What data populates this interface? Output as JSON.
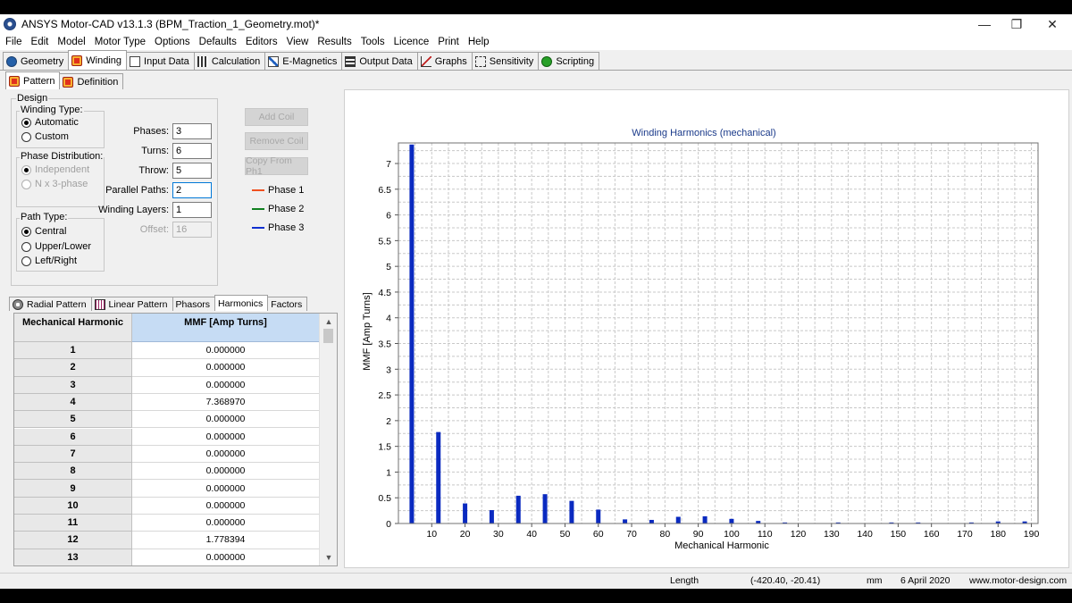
{
  "window": {
    "title": "ANSYS Motor-CAD v13.1.3 (BPM_Traction_1_Geometry.mot)*",
    "minimize": "—",
    "restore": "❐",
    "close": "✕"
  },
  "menu": [
    "File",
    "Edit",
    "Model",
    "Motor Type",
    "Options",
    "Defaults",
    "Editors",
    "View",
    "Results",
    "Tools",
    "Licence",
    "Print",
    "Help"
  ],
  "main_tabs": [
    "Geometry",
    "Winding",
    "Input Data",
    "Calculation",
    "E-Magnetics",
    "Output Data",
    "Graphs",
    "Sensitivity",
    "Scripting"
  ],
  "sub_tabs": [
    "Pattern",
    "Definition"
  ],
  "design": {
    "group_label": "Design",
    "winding_type": {
      "label": "Winding Type:",
      "options": [
        "Automatic",
        "Custom"
      ],
      "selected": "Automatic"
    },
    "phase_distribution": {
      "label": "Phase Distribution:",
      "options": [
        "Independent",
        "N x 3-phase"
      ],
      "selected": "Independent"
    },
    "path_type": {
      "label": "Path Type:",
      "options": [
        "Central",
        "Upper/Lower",
        "Left/Right"
      ],
      "selected": "Central"
    },
    "fields": [
      {
        "label": "Phases:",
        "value": "3"
      },
      {
        "label": "Turns:",
        "value": "6"
      },
      {
        "label": "Throw:",
        "value": "5"
      },
      {
        "label": "Parallel Paths:",
        "value": "2"
      },
      {
        "label": "Winding Layers:",
        "value": "1"
      },
      {
        "label": "Offset:",
        "value": "16"
      }
    ],
    "buttons": [
      "Add Coil",
      "Remove Coil",
      "Copy From Ph1"
    ],
    "phase_legend": [
      {
        "name": "Phase 1",
        "color": "#f05020"
      },
      {
        "name": "Phase 2",
        "color": "#108020"
      },
      {
        "name": "Phase 3",
        "color": "#1030d0"
      }
    ]
  },
  "lower_tabs": [
    "Radial Pattern",
    "Linear Pattern",
    "Phasors",
    "Harmonics",
    "Factors"
  ],
  "harmonics_table": {
    "headers": [
      "Mechanical Harmonic",
      "MMF [Amp Turns]"
    ],
    "rows": [
      [
        "1",
        "0.000000"
      ],
      [
        "2",
        "0.000000"
      ],
      [
        "3",
        "0.000000"
      ],
      [
        "4",
        "7.368970"
      ],
      [
        "5",
        "0.000000"
      ],
      [
        "6",
        "0.000000"
      ],
      [
        "7",
        "0.000000"
      ],
      [
        "8",
        "0.000000"
      ],
      [
        "9",
        "0.000000"
      ],
      [
        "10",
        "0.000000"
      ],
      [
        "11",
        "0.000000"
      ],
      [
        "12",
        "1.778394"
      ],
      [
        "13",
        "0.000000"
      ]
    ]
  },
  "chart_data": {
    "type": "bar",
    "title": "Winding Harmonics (mechanical)",
    "xlabel": "Mechanical Harmonic",
    "ylabel": "MMF [Amp Turns]",
    "xlim": [
      0,
      192
    ],
    "ylim": [
      0,
      7.4
    ],
    "xticks": [
      10,
      20,
      30,
      40,
      50,
      60,
      70,
      80,
      90,
      100,
      110,
      120,
      130,
      140,
      150,
      160,
      170,
      180,
      190
    ],
    "yticks": [
      0,
      0.5,
      1,
      1.5,
      2,
      2.5,
      3,
      3.5,
      4,
      4.5,
      5,
      5.5,
      6,
      6.5,
      7
    ],
    "grid": true,
    "color": "#0a2ac0",
    "x": [
      4,
      12,
      20,
      28,
      36,
      44,
      52,
      60,
      68,
      76,
      84,
      92,
      100,
      108,
      116,
      132,
      148,
      156,
      172,
      180,
      188
    ],
    "values": [
      7.36897,
      1.778394,
      0.39,
      0.26,
      0.54,
      0.57,
      0.44,
      0.27,
      0.08,
      0.07,
      0.13,
      0.14,
      0.09,
      0.05,
      0.02,
      0.02,
      0.02,
      0.02,
      0.02,
      0.04,
      0.04
    ]
  },
  "status": {
    "field": "Length",
    "coords": "(-420.40, -20.41)",
    "units": "mm",
    "date": "6 April 2020",
    "website": "www.motor-design.com"
  }
}
